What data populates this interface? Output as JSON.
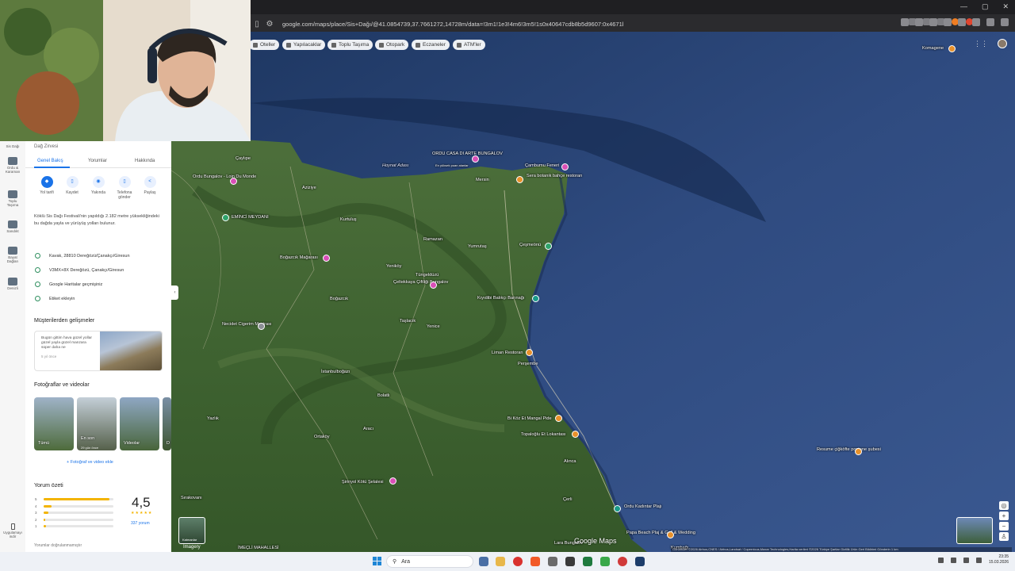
{
  "browser": {
    "url": "google.com/maps/place/Sis+Dağı/@41.0854739,37.7661272,14728m/data=!3m1!1e3!4m6!3m5!1s0x40647cdb8b5d9607:0x4671b505e169..."
  },
  "map": {
    "chips": [
      {
        "label": "Oteller"
      },
      {
        "label": "Yapılacaklar"
      },
      {
        "label": "Toplu Taşıma"
      },
      {
        "label": "Otopark"
      },
      {
        "label": "Eczaneler"
      },
      {
        "label": "ATM'ler"
      }
    ],
    "places": [
      {
        "name": "Çaylıpe",
        "kind": "town"
      },
      {
        "name": "Ordu Bungalov - Loin Du Monde",
        "kind": "pink"
      },
      {
        "name": "Aziziye",
        "kind": "town"
      },
      {
        "name": "Hoynat Adası",
        "kind": "sea"
      },
      {
        "name": "ORDU CASA DI ARTE BUNGALOV",
        "kind": "pink"
      },
      {
        "name": "En yüksek puan alanlar",
        "kind": "sub"
      },
      {
        "name": "Mersin",
        "kind": "town"
      },
      {
        "name": "Sera botanik bahçe restoran",
        "kind": "orange"
      },
      {
        "name": "Çambumu Feneri",
        "kind": "pink"
      },
      {
        "name": "EMİNCİ MEYDANI",
        "kind": "green"
      },
      {
        "name": "Kurtuluş",
        "kind": "town"
      },
      {
        "name": "Ramazan",
        "kind": "town"
      },
      {
        "name": "Yumrutaş",
        "kind": "town"
      },
      {
        "name": "Çeşmeönü",
        "kind": "green"
      },
      {
        "name": "Boğazcık Mağarası",
        "kind": "pink"
      },
      {
        "name": "Yeniköy",
        "kind": "town"
      },
      {
        "name": "Tüngeldüzü",
        "kind": "town"
      },
      {
        "name": "Çeltekkaya Çiftliği Bungalov",
        "kind": "pink"
      },
      {
        "name": "Boğazcık",
        "kind": "town"
      },
      {
        "name": "Kıyıdibi Balıkçı Barınağı",
        "kind": "teal"
      },
      {
        "name": "Necidet Cigerim Mesirası",
        "kind": "gray"
      },
      {
        "name": "Taşlacık",
        "kind": "town"
      },
      {
        "name": "Yenice",
        "kind": "town"
      },
      {
        "name": "Liman Restoran",
        "kind": "orange"
      },
      {
        "name": "Perşembe",
        "kind": "town"
      },
      {
        "name": "İstanbulboğazı",
        "kind": "town"
      },
      {
        "name": "Bolatlı",
        "kind": "town"
      },
      {
        "name": "Yazlık",
        "kind": "town"
      },
      {
        "name": "Bi Köz Et Mangal Pide",
        "kind": "orange"
      },
      {
        "name": "Topaloğlu Et Lokantası",
        "kind": "orange"
      },
      {
        "name": "Ortaköy",
        "kind": "town"
      },
      {
        "name": "Aracı",
        "kind": "town"
      },
      {
        "name": "Alınca",
        "kind": "town"
      },
      {
        "name": "Şirinyol Kötü Şelalesi",
        "kind": "pink"
      },
      {
        "name": "Çerli",
        "kind": "town"
      },
      {
        "name": "Ordu Kadıntar Plajı",
        "kind": "teal"
      },
      {
        "name": "Sırakovanı",
        "kind": "town"
      },
      {
        "name": "Lara Bungalov",
        "kind": "town"
      },
      {
        "name": "Papa Beach Plaj & Grill & Wedding",
        "kind": "orange"
      },
      {
        "name": "Kumbağı",
        "kind": "town"
      },
      {
        "name": "İMEÇLİ MAHALLESİ",
        "kind": "town"
      },
      {
        "name": "Komagene",
        "kind": "orange"
      },
      {
        "name": "Resume çiğköfte postane şubesi",
        "kind": "orange"
      }
    ],
    "layers_label": "Katmanlar",
    "imagery_label": "İmagery",
    "logo": "Google Maps",
    "attribution": "Görüntüler ©2026 Airbus,CNES / Airbus,Landsat / Copernicus,Maxar Technologies,Harita verileri ©2026  Türkiye  Şartlar  Gizlilik  Ürün Geri Bildirimi Gönderin  1 km"
  },
  "side_nav": {
    "items": [
      {
        "label": "Sis Dağı"
      },
      {
        "label": "Ordu & Karaman"
      },
      {
        "label": "Toplu Taşıma"
      },
      {
        "label": "Sandıkt"
      },
      {
        "label": "Bayat Dağları"
      },
      {
        "label": "Denizli"
      }
    ],
    "bottom": "Uygulamayı indir"
  },
  "panel": {
    "title": "Dağ Zirvesi",
    "tabs": [
      "Genel Bakış",
      "Yorumlar",
      "Hakkında"
    ],
    "actions": [
      {
        "label": "Yol tarifi",
        "icon": "◆"
      },
      {
        "label": "Kaydet",
        "icon": "▯"
      },
      {
        "label": "Yakında",
        "icon": "◉"
      },
      {
        "label": "Telefona gönder",
        "icon": "▯"
      },
      {
        "label": "Paylaş",
        "icon": "<"
      }
    ],
    "description": "Köklü Sis Dağı Festivali'nin yapıldığı 2.182 metre yüksekliğindeki bu dağda yayla ve yürüyüş yolları bulunur.",
    "info": [
      {
        "text": "Kavak, 28810 Dereğözü/Çanakçı/Giresun"
      },
      {
        "text": "V3MX+8X Dereğözü, Çanakçı/Giresun"
      },
      {
        "text": "Google Haritalar geçmişiniz"
      },
      {
        "text": "Etiket ekleyin"
      }
    ],
    "devs_title": "Müşterilerden gelişmeler",
    "devs_text": "Bugün gittim hava güzel yollar güzel yayla güzel manzara süper daha ne",
    "devs_age": "5 yıl önce",
    "photos_title": "Fotoğraflar ve videolar",
    "photos": [
      {
        "label": "Tümü",
        "sub": ""
      },
      {
        "label": "En son",
        "sub": "29 gün önce"
      },
      {
        "label": "Videolar",
        "sub": ""
      },
      {
        "label": "D",
        "sub": ""
      }
    ],
    "add_photo": "+ Fotoğraf ve video ekle",
    "rating_title": "Yorum özeti",
    "rating_bars": [
      {
        "star": "5",
        "fraction": 0.95
      },
      {
        "star": "4",
        "fraction": 0.12
      },
      {
        "star": "3",
        "fraction": 0.07
      },
      {
        "star": "2",
        "fraction": 0.03
      },
      {
        "star": "1",
        "fraction": 0.04
      }
    ],
    "score": "4,5",
    "stars": "★★★★★",
    "reviews_count": "337 yorum",
    "verify_text": "Yorumlar doğrulanmamıştır"
  },
  "taskbar": {
    "search_placeholder": "Ara",
    "time": "23:35",
    "date": "15.03.2026"
  },
  "colors": {
    "accent": "#1a73e8",
    "star": "#f3b400",
    "sea": "#27406d"
  }
}
